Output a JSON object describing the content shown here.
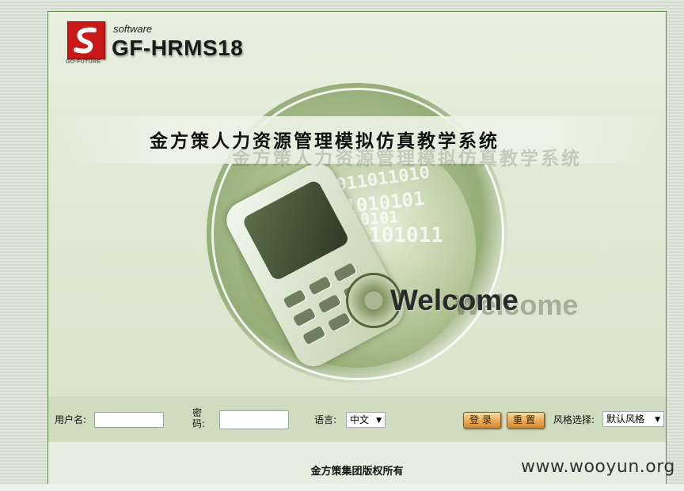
{
  "header": {
    "logo_caption": "GO-FUTURE",
    "software_label": "software",
    "product_name": "GF-HRMS18"
  },
  "banner": {
    "title": "金方策人力资源管理模拟仿真教学系统",
    "welcome": "Welcome",
    "binary_rows": [
      "1011011010",
      "01010101",
      "1010101",
      "101011",
      "101"
    ]
  },
  "login": {
    "username_label": "用户名:",
    "username_value": "",
    "password_label": "密码:",
    "password_value": "",
    "language_label": "语言:",
    "language_value": "中文",
    "login_button": "登录",
    "reset_button": "重置",
    "style_label": "风格选择:",
    "style_value": "默认风格"
  },
  "footer": {
    "copyright": "金方策集团版权所有"
  },
  "watermark": "www.wooyun.org",
  "colors": {
    "brand_red": "#c81818",
    "button_orange": "#e7aa58",
    "page_green": "#dfe8d2"
  }
}
